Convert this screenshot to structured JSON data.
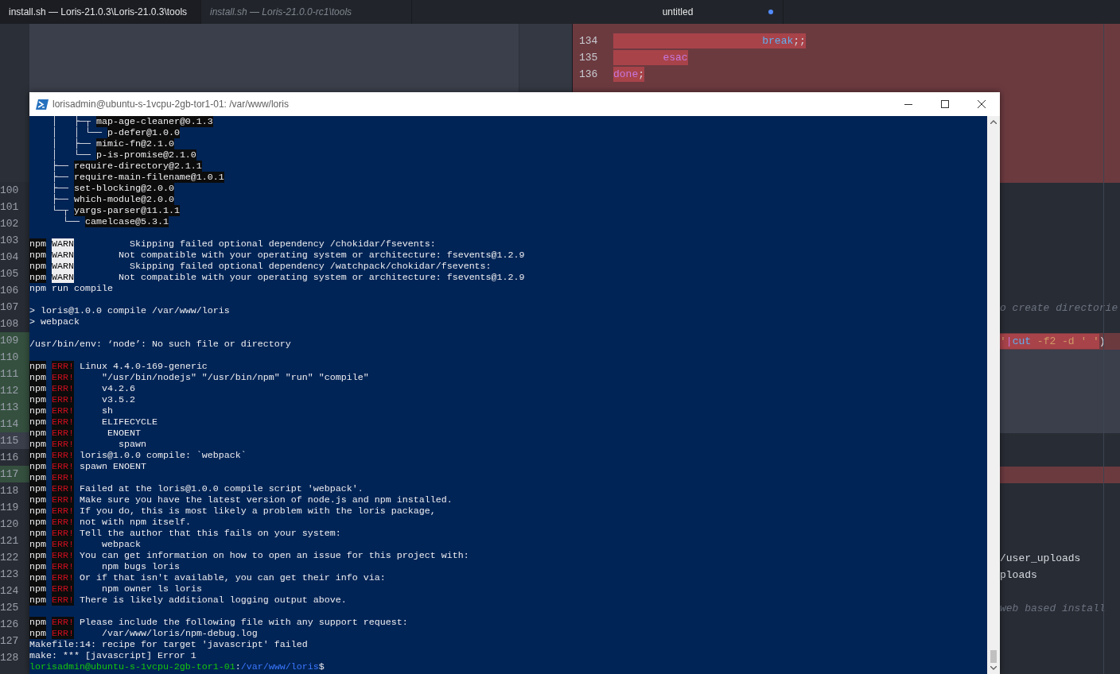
{
  "tabs": [
    {
      "label": "install.sh — Loris-21.0.3\\Loris-21.0.3\\tools",
      "selected": true,
      "italic": false
    },
    {
      "label": "install.sh — Loris-21.0.0-rc1\\tools",
      "selected": false,
      "italic": true
    }
  ],
  "right_tab": {
    "label": "untitled",
    "modified": true
  },
  "left_editor": {
    "lines": [
      {
        "number": "100",
        "kind": "normal"
      },
      {
        "number": "101",
        "kind": "normal"
      },
      {
        "number": "102",
        "kind": "normal"
      },
      {
        "number": "103",
        "kind": "normal"
      },
      {
        "number": "104",
        "kind": "normal"
      },
      {
        "number": "105",
        "kind": "normal"
      },
      {
        "number": "106",
        "kind": "normal"
      },
      {
        "number": "107",
        "kind": "normal"
      },
      {
        "number": "108",
        "kind": "normal"
      },
      {
        "number": "109",
        "kind": "added"
      },
      {
        "number": "110",
        "kind": "added"
      },
      {
        "number": "111",
        "kind": "added"
      },
      {
        "number": "112",
        "kind": "added"
      },
      {
        "number": "113",
        "kind": "added"
      },
      {
        "number": "114",
        "kind": "added"
      },
      {
        "number": "115",
        "kind": "gray"
      },
      {
        "number": "116",
        "kind": "normal"
      },
      {
        "number": "117",
        "kind": "added"
      },
      {
        "number": "118",
        "kind": "normal"
      },
      {
        "number": "119",
        "kind": "normal"
      },
      {
        "number": "120",
        "kind": "normal"
      },
      {
        "number": "121",
        "kind": "normal"
      },
      {
        "number": "122",
        "kind": "normal"
      },
      {
        "number": "123",
        "kind": "normal"
      },
      {
        "number": "124",
        "kind": "normal"
      },
      {
        "number": "125",
        "kind": "normal"
      },
      {
        "number": "126",
        "kind": "normal"
      },
      {
        "number": "127",
        "kind": "normal"
      },
      {
        "number": "128",
        "kind": "normal"
      }
    ]
  },
  "right_editor": {
    "lines": [
      {
        "kind": "changed"
      },
      {
        "number": "134",
        "kind": "changed",
        "tokens": [
          {
            "text": "                        break",
            "kind": "function"
          },
          {
            "text": ";;",
            "kind": "plain"
          }
        ]
      },
      {
        "number": "135",
        "kind": "changed",
        "tokens": [
          {
            "text": "        esac",
            "kind": "keyword"
          }
        ]
      },
      {
        "number": "136",
        "kind": "changed",
        "tokens": [
          {
            "text": "done",
            "kind": "keyword"
          },
          {
            "text": ";",
            "kind": "plain"
          }
        ]
      },
      {
        "kind": "changed"
      },
      {
        "kind": "changed"
      },
      {
        "kind": "changed"
      },
      {
        "kind": "changed"
      },
      {
        "kind": "changed"
      },
      {
        "kind": "changed"
      },
      {
        "kind": "normal"
      },
      {
        "kind": "normal"
      },
      {
        "kind": "normal"
      },
      {
        "kind": "normal"
      },
      {
        "kind": "normal"
      },
      {
        "kind": "normal"
      },
      {
        "kind": "normal"
      },
      {
        "kind": "normal",
        "tokens": [
          {
            "text": "o create directorie",
            "kind": "comment"
          }
        ]
      },
      {
        "kind": "normal"
      },
      {
        "kind": "changed",
        "tokens": [
          {
            "text": "'",
            "kind": "string"
          },
          {
            "text": "|",
            "kind": "keyword"
          },
          {
            "text": "cut",
            "kind": "function"
          },
          {
            "text": " -f2 -d ' '",
            "kind": "string"
          },
          {
            "text": ")",
            "kind": "plain",
            "unchanged": true
          }
        ]
      },
      {
        "kind": "gray"
      },
      {
        "kind": "gray"
      },
      {
        "kind": "gray"
      },
      {
        "kind": "gray"
      },
      {
        "kind": "gray"
      },
      {
        "kind": "normal"
      },
      {
        "kind": "normal"
      },
      {
        "kind": "changed"
      },
      {
        "kind": "normal"
      },
      {
        "kind": "normal"
      },
      {
        "kind": "normal"
      },
      {
        "kind": "normal"
      },
      {
        "kind": "normal",
        "tokens": [
          {
            "text": "/user_uploads",
            "kind": "plain"
          }
        ]
      },
      {
        "kind": "normal",
        "tokens": [
          {
            "text": "ploads",
            "kind": "plain"
          }
        ]
      },
      {
        "kind": "normal"
      },
      {
        "kind": "normal",
        "tokens": [
          {
            "text": "web based install",
            "kind": "comment"
          }
        ]
      }
    ]
  },
  "terminal": {
    "title": "lorisadmin@ubuntu-s-1vcpu-2gb-tor1-01: /var/www/loris",
    "lines": [
      {
        "kind": "tree",
        "prefix": "    │   ├─┬ ",
        "package": "map-age-cleaner@0.1.3"
      },
      {
        "kind": "tree",
        "prefix": "    │   │ └── ",
        "package": "p-defer@1.0.0"
      },
      {
        "kind": "tree",
        "prefix": "    │   ├── ",
        "package": "mimic-fn@2.1.0"
      },
      {
        "kind": "tree",
        "prefix": "    │   └── ",
        "package": "p-is-promise@2.1.0"
      },
      {
        "kind": "tree",
        "prefix": "    ├── ",
        "package": "require-directory@2.1.1"
      },
      {
        "kind": "tree",
        "prefix": "    ├── ",
        "package": "require-main-filename@1.0.1"
      },
      {
        "kind": "tree",
        "prefix": "    ├── ",
        "package": "set-blocking@2.0.0"
      },
      {
        "kind": "tree",
        "prefix": "    ├── ",
        "package": "which-module@2.0.0"
      },
      {
        "kind": "tree",
        "prefix": "    └─┬ ",
        "package": "yargs-parser@11.1.1"
      },
      {
        "kind": "tree",
        "prefix": "      └── ",
        "package": "camelcase@5.3.1"
      },
      {
        "kind": "blank"
      },
      {
        "kind": "warn",
        "source": "npm",
        "badge": "WARN",
        "text": "         Skipping failed optional dependency /chokidar/fsevents:"
      },
      {
        "kind": "warn",
        "source": "npm",
        "badge": "WARN",
        "text": "       Not compatible with your operating system or architecture: fsevents@1.2.9"
      },
      {
        "kind": "warn",
        "source": "npm",
        "badge": "WARN",
        "text": "         Skipping failed optional dependency /watchpack/chokidar/fsevents:"
      },
      {
        "kind": "warn",
        "source": "npm",
        "badge": "WARN",
        "text": "       Not compatible with your operating system or architecture: fsevents@1.2.9"
      },
      {
        "kind": "plain",
        "text": "npm run compile"
      },
      {
        "kind": "blank"
      },
      {
        "kind": "plain",
        "text": "> loris@1.0.0 compile /var/www/loris"
      },
      {
        "kind": "plain",
        "text": "> webpack"
      },
      {
        "kind": "blank"
      },
      {
        "kind": "plain",
        "text": "/usr/bin/env: ‘node’: No such file or directory"
      },
      {
        "kind": "blank"
      },
      {
        "kind": "err",
        "source": "npm",
        "badge": "ERR!",
        "text": "Linux 4.4.0-169-generic"
      },
      {
        "kind": "err",
        "source": "npm",
        "badge": "ERR!",
        "text": "    \"/usr/bin/nodejs\" \"/usr/bin/npm\" \"run\" \"compile\""
      },
      {
        "kind": "err",
        "source": "npm",
        "badge": "ERR!",
        "text": "    v4.2.6"
      },
      {
        "kind": "err",
        "source": "npm",
        "badge": "ERR!",
        "text": "    v3.5.2"
      },
      {
        "kind": "err",
        "source": "npm",
        "badge": "ERR!",
        "text": "    sh"
      },
      {
        "kind": "err",
        "source": "npm",
        "badge": "ERR!",
        "text": "    ELIFECYCLE"
      },
      {
        "kind": "err",
        "source": "npm",
        "badge": "ERR!",
        "text": "     ENOENT"
      },
      {
        "kind": "err",
        "source": "npm",
        "badge": "ERR!",
        "text": "       spawn"
      },
      {
        "kind": "err",
        "source": "npm",
        "badge": "ERR!",
        "text": "loris@1.0.0 compile: `webpack`"
      },
      {
        "kind": "err",
        "source": "npm",
        "badge": "ERR!",
        "text": "spawn ENOENT"
      },
      {
        "kind": "err",
        "source": "npm",
        "badge": "ERR!"
      },
      {
        "kind": "err",
        "source": "npm",
        "badge": "ERR!",
        "text": "Failed at the loris@1.0.0 compile script 'webpack'."
      },
      {
        "kind": "err",
        "source": "npm",
        "badge": "ERR!",
        "text": "Make sure you have the latest version of node.js and npm installed."
      },
      {
        "kind": "err",
        "source": "npm",
        "badge": "ERR!",
        "text": "If you do, this is most likely a problem with the loris package,"
      },
      {
        "kind": "err",
        "source": "npm",
        "badge": "ERR!",
        "text": "not with npm itself."
      },
      {
        "kind": "err",
        "source": "npm",
        "badge": "ERR!",
        "text": "Tell the author that this fails on your system:"
      },
      {
        "kind": "err",
        "source": "npm",
        "badge": "ERR!",
        "text": "    webpack"
      },
      {
        "kind": "err",
        "source": "npm",
        "badge": "ERR!",
        "text": "You can get information on how to open an issue for this project with:"
      },
      {
        "kind": "err",
        "source": "npm",
        "badge": "ERR!",
        "text": "    npm bugs loris"
      },
      {
        "kind": "err",
        "source": "npm",
        "badge": "ERR!",
        "text": "Or if that isn't available, you can get their info via:"
      },
      {
        "kind": "err",
        "source": "npm",
        "badge": "ERR!",
        "text": "    npm owner ls loris"
      },
      {
        "kind": "err",
        "source": "npm",
        "badge": "ERR!",
        "text": "There is likely additional logging output above."
      },
      {
        "kind": "blank"
      },
      {
        "kind": "err",
        "source": "npm",
        "badge": "ERR!",
        "text": "Please include the following file with any support request:"
      },
      {
        "kind": "err",
        "source": "npm",
        "badge": "ERR!",
        "text": "    /var/www/loris/npm-debug.log"
      },
      {
        "kind": "plain",
        "text": "Makefile:14: recipe for target 'javascript' failed"
      },
      {
        "kind": "plain",
        "text": "make: *** [javascript] Error 1"
      },
      {
        "kind": "prompt",
        "user": "lorisadmin@ubuntu-s-1vcpu-2gb-tor1-01",
        "separator": ":",
        "path": "/var/www/loris",
        "symbol": "$"
      }
    ]
  }
}
